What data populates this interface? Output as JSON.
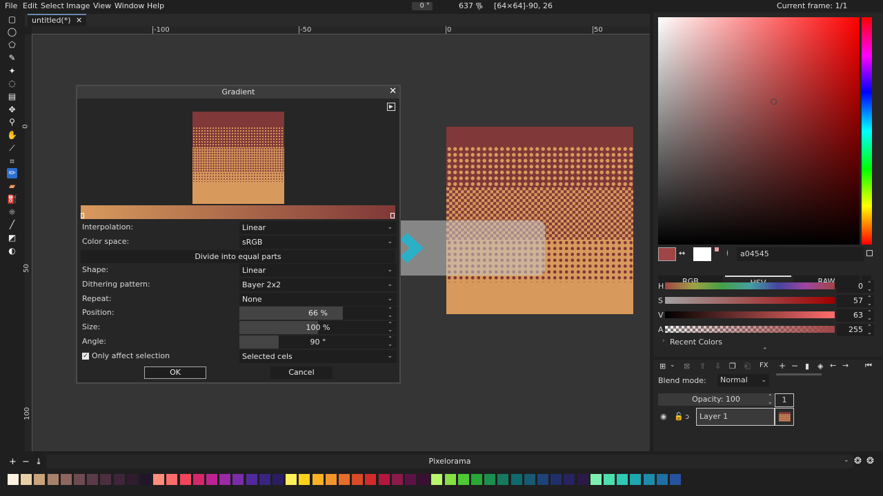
{
  "menubar": {
    "items": [
      "File",
      "Edit",
      "Select",
      "Image",
      "View",
      "Window",
      "Help"
    ],
    "rotation": "0 °",
    "zoom": "637 %",
    "size": "[64×64]",
    "cursor_pos": "-90, 26",
    "current_frame": "Current frame: 1/1"
  },
  "tabs": [
    {
      "label": "untitled(*)",
      "close": "✕"
    }
  ],
  "rulers": {
    "h": [
      "-100",
      "-50",
      "0",
      "50"
    ],
    "v": [
      "0",
      "50",
      "100"
    ]
  },
  "dialog": {
    "title": "Gradient",
    "close": "✕",
    "interpolation_label": "Interpolation:",
    "interpolation_value": "Linear",
    "color_space_label": "Color space:",
    "color_space_value": "sRGB",
    "divide_button": "Divide into equal parts",
    "shape_label": "Shape:",
    "shape_value": "Linear",
    "dithering_label": "Dithering pattern:",
    "dithering_value": "Bayer 2x2",
    "repeat_label": "Repeat:",
    "repeat_value": "None",
    "position_label": "Position:",
    "position_value": "66 %",
    "position_fraction": 0.66,
    "size_label": "Size:",
    "size_value": "100 %",
    "size_fraction": 0.5,
    "angle_label": "Angle:",
    "angle_value": "90 °",
    "angle_fraction": 0.25,
    "only_affect_label": "Only affect selection",
    "only_affect_checked": true,
    "affect_value": "Selected cels",
    "ok": "OK",
    "cancel": "Cancel"
  },
  "color_picker": {
    "hex": "a04545",
    "modes": [
      "RGB",
      "HSV",
      "RAW"
    ],
    "active_mode": "HSV",
    "channels": [
      {
        "label": "H",
        "value": "0",
        "fraction": 0.0
      },
      {
        "label": "S",
        "value": "57",
        "fraction": 0.57
      },
      {
        "label": "V",
        "value": "63",
        "fraction": 0.63
      },
      {
        "label": "A",
        "value": "255",
        "fraction": 1.0
      }
    ],
    "recent_colors": "Recent Colors",
    "primary_color": "#a04545",
    "secondary_color": "#ffffff"
  },
  "layers": {
    "blend_label": "Blend mode:",
    "blend_value": "Normal",
    "opacity": "Opacity: 100",
    "frame_number": "1",
    "layer_name": "Layer 1"
  },
  "palette": {
    "name": "Pixelorama",
    "colors": [
      "#fff2e0",
      "#e8cfa6",
      "#c9a37c",
      "#a8816a",
      "#8f6560",
      "#6e4b50",
      "#5b3b48",
      "#4b2e40",
      "#3f2539",
      "#311b2f",
      "#22142b",
      "#ff8e7a",
      "#ff6b6b",
      "#f0455c",
      "#d6276b",
      "#c02292",
      "#9b2aa5",
      "#7b2ca8",
      "#52299c",
      "#3a2481",
      "#2b1d63",
      "#ffef5c",
      "#ffd11a",
      "#f9b125",
      "#f2952c",
      "#e66d2b",
      "#d84b26",
      "#d42a2a",
      "#b3173c",
      "#8b1a4a",
      "#5c1246",
      "#3a0f33",
      "#b9f56d",
      "#87e045",
      "#4ec933",
      "#2aa736",
      "#1c8f4f",
      "#157a5d",
      "#0f6a6b",
      "#165a73",
      "#1d4379",
      "#202e69",
      "#272261",
      "#2a1a4a",
      "#7cf0b3",
      "#4ce0b0",
      "#2fc9b4",
      "#1fa7b0",
      "#1f8bab",
      "#1e6fa3",
      "#2553a0"
    ]
  }
}
